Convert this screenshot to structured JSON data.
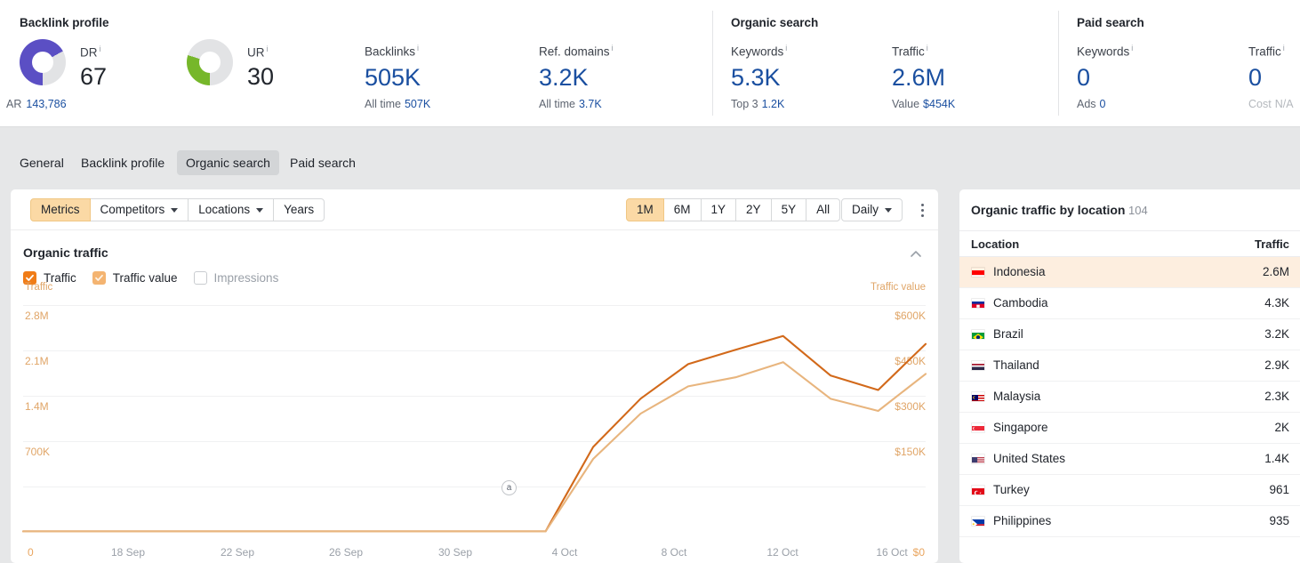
{
  "topbar": {
    "groups": [
      {
        "title": "Backlink profile",
        "gauges": [
          {
            "label": "DR",
            "value": "67",
            "percent": 67,
            "color": "#5b4fc4",
            "info": "i"
          },
          {
            "label": "UR",
            "value": "30",
            "percent": 30,
            "color": "#76b72a",
            "info": "i"
          }
        ],
        "ar": {
          "label": "AR",
          "value": "143,786"
        },
        "metrics": [
          {
            "label": "Backlinks",
            "value": "505K",
            "sub_label": "All time",
            "sub_value": "507K",
            "info": "i"
          },
          {
            "label": "Ref. domains",
            "value": "3.2K",
            "sub_label": "All time",
            "sub_value": "3.7K",
            "info": "i"
          }
        ]
      },
      {
        "title": "Organic search",
        "metrics": [
          {
            "label": "Keywords",
            "value": "5.3K",
            "sub_label": "Top 3",
            "sub_value": "1.2K",
            "info": "i"
          },
          {
            "label": "Traffic",
            "value": "2.6M",
            "sub_label": "Value",
            "sub_value": "$454K",
            "info": "i"
          }
        ]
      },
      {
        "title": "Paid search",
        "metrics": [
          {
            "label": "Keywords",
            "value": "0",
            "sub_label": "Ads",
            "sub_value": "0",
            "info": "i"
          },
          {
            "label": "Traffic",
            "value": "0",
            "sub_label": "Cost",
            "sub_value": "N/A",
            "muted": true,
            "info": "i"
          }
        ]
      }
    ]
  },
  "nav": {
    "tabs": [
      {
        "label": "General",
        "active": false
      },
      {
        "label": "Backlink profile",
        "active": false
      },
      {
        "label": "Organic search",
        "active": true
      },
      {
        "label": "Paid search",
        "active": false
      }
    ]
  },
  "toolbar": {
    "filters": [
      {
        "label": "Metrics",
        "selected": true,
        "caret": false
      },
      {
        "label": "Competitors",
        "selected": false,
        "caret": true
      },
      {
        "label": "Locations",
        "selected": false,
        "caret": true
      },
      {
        "label": "Years",
        "selected": false,
        "caret": false
      }
    ],
    "ranges": [
      {
        "label": "1M",
        "selected": true
      },
      {
        "label": "6M",
        "selected": false
      },
      {
        "label": "1Y",
        "selected": false
      },
      {
        "label": "2Y",
        "selected": false
      },
      {
        "label": "5Y",
        "selected": false
      },
      {
        "label": "All",
        "selected": false
      }
    ],
    "granularity": {
      "label": "Daily",
      "caret": true
    },
    "more_menu_icon": "kebab-menu-icon"
  },
  "chart_panel": {
    "title": "Organic traffic",
    "collapse_icon": "chevron-up-icon",
    "legend": [
      {
        "label": "Traffic",
        "state": "on"
      },
      {
        "label": "Traffic value",
        "state": "half"
      },
      {
        "label": "Impressions",
        "state": "off"
      }
    ]
  },
  "chart_data": {
    "type": "line",
    "title": "Organic traffic",
    "xlabel": "",
    "ylabel": "Traffic",
    "y2label": "Traffic value",
    "grid": true,
    "legend_position": "top-left",
    "x_tick_labels": [
      "18 Sep",
      "22 Sep",
      "26 Sep",
      "30 Sep",
      "4 Oct",
      "8 Oct",
      "12 Oct",
      "16 Oct"
    ],
    "y_tick_labels": [
      "0",
      "700K",
      "1.4M",
      "2.1M",
      "2.8M"
    ],
    "y2_tick_labels": [
      "$0",
      "$150K",
      "$300K",
      "$450K",
      "$600K"
    ],
    "ylim": [
      0,
      3150000
    ],
    "y2lim": [
      0,
      675000
    ],
    "annotations": [
      {
        "label": "a",
        "x": "2 Oct"
      }
    ],
    "series": [
      {
        "name": "Traffic",
        "color": "#d2691a",
        "axis": "left",
        "x": [
          "16 Sep",
          "18 Sep",
          "20 Sep",
          "22 Sep",
          "24 Sep",
          "26 Sep",
          "28 Sep",
          "30 Sep",
          "2 Oct",
          "4 Oct",
          "6 Oct",
          "8 Oct",
          "9 Oct",
          "10 Oct",
          "11 Oct",
          "12 Oct",
          "13 Oct",
          "14 Oct",
          "15 Oct",
          "16 Oct"
        ],
        "values": [
          8000,
          8000,
          8000,
          8000,
          8000,
          8000,
          8000,
          8000,
          8000,
          8000,
          8000,
          8000,
          1180000,
          1850000,
          2330000,
          2530000,
          2720000,
          2170000,
          1970000,
          2610000
        ]
      },
      {
        "name": "Traffic value",
        "color": "#e8b57e",
        "axis": "right",
        "x": [
          "16 Sep",
          "18 Sep",
          "20 Sep",
          "22 Sep",
          "24 Sep",
          "26 Sep",
          "28 Sep",
          "30 Sep",
          "2 Oct",
          "4 Oct",
          "6 Oct",
          "8 Oct",
          "9 Oct",
          "10 Oct",
          "11 Oct",
          "12 Oct",
          "13 Oct",
          "14 Oct",
          "15 Oct",
          "16 Oct"
        ],
        "values": [
          1500,
          1500,
          1500,
          1500,
          1500,
          1500,
          1500,
          1500,
          1500,
          1500,
          1500,
          1500,
          217000,
          352000,
          433000,
          460000,
          505000,
          396000,
          360000,
          470000
        ]
      }
    ]
  },
  "locations_panel": {
    "title": "Organic traffic by location",
    "count": "104",
    "columns": {
      "location": "Location",
      "traffic": "Traffic"
    },
    "rows": [
      {
        "name": "Indonesia",
        "traffic": "2.6M",
        "pct": "9",
        "highlight": true,
        "flag": "id"
      },
      {
        "name": "Cambodia",
        "traffic": "4.3K",
        "pct": "",
        "highlight": false,
        "flag": "kh"
      },
      {
        "name": "Brazil",
        "traffic": "3.2K",
        "pct": "",
        "highlight": false,
        "flag": "br"
      },
      {
        "name": "Thailand",
        "traffic": "2.9K",
        "pct": "",
        "highlight": false,
        "flag": "th"
      },
      {
        "name": "Malaysia",
        "traffic": "2.3K",
        "pct": "",
        "highlight": false,
        "flag": "my"
      },
      {
        "name": "Singapore",
        "traffic": "2K",
        "pct": "",
        "highlight": false,
        "flag": "sg"
      },
      {
        "name": "United States",
        "traffic": "1.4K",
        "pct": "",
        "highlight": false,
        "flag": "us"
      },
      {
        "name": "Turkey",
        "traffic": "961",
        "pct": "",
        "highlight": false,
        "flag": "tr"
      },
      {
        "name": "Philippines",
        "traffic": "935",
        "pct": "",
        "highlight": false,
        "flag": "ph"
      }
    ]
  }
}
